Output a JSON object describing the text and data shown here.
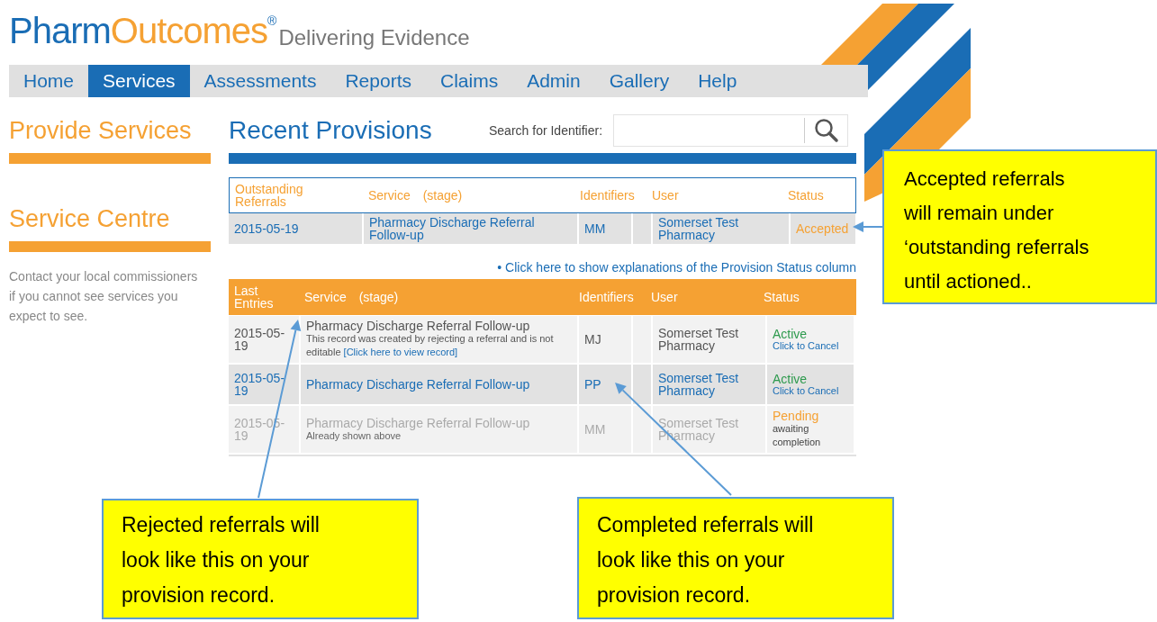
{
  "header": {
    "logo_first": "Pharm",
    "logo_second": "Outcomes",
    "registered_mark": "®",
    "tagline": "Delivering Evidence"
  },
  "nav": [
    {
      "label": "Home",
      "selected": false
    },
    {
      "label": "Services",
      "selected": true
    },
    {
      "label": "Assessments",
      "selected": false
    },
    {
      "label": "Reports",
      "selected": false
    },
    {
      "label": "Claims",
      "selected": false
    },
    {
      "label": "Admin",
      "selected": false
    },
    {
      "label": "Gallery",
      "selected": false
    },
    {
      "label": "Help",
      "selected": false
    }
  ],
  "sidebar": [
    {
      "title": "Provide Services"
    },
    {
      "title": "Service Centre",
      "text": "Contact your local commissioners if you cannot see services you expect to see."
    }
  ],
  "main": {
    "title": "Recent Provisions",
    "search": {
      "label": "Search for Identifier:"
    },
    "outstanding": {
      "columns": {
        "date": "Outstanding Referrals",
        "service": "Service",
        "stage": "(stage)",
        "identifiers": "Identifiers",
        "user": "User",
        "status": "Status"
      },
      "rows": [
        {
          "kind": "link",
          "date": "2015-05-19",
          "service": "Pharmacy Discharge Referral Follow-up",
          "identifiers": "MM",
          "user": "Somerset Test Pharmacy",
          "status": {
            "text": "Accepted",
            "color": "#f5a133"
          }
        }
      ]
    },
    "explanations_link": "• Click here to show explanations of the Provision Status column",
    "last_entries": {
      "columns": {
        "date": "Last Entries",
        "service": "Service",
        "stage": "(stage)",
        "identifiers": "Identifiers",
        "user": "User",
        "status": "Status"
      },
      "rows": [
        {
          "kind": "plain",
          "date": "2015-05-19",
          "service": "Pharmacy Discharge Referral Follow-up",
          "note": "This record was created by rejecting a referral and is not editable",
          "note_link": "[Click here to view record]",
          "identifiers": "MJ",
          "user": "Somerset Test Pharmacy",
          "status": {
            "text": "Active",
            "color": "#2e9a4e"
          },
          "status_action": "Click to Cancel"
        },
        {
          "kind": "link",
          "date": "2015-05-19",
          "service": "Pharmacy Discharge Referral Follow-up",
          "identifiers": "PP",
          "user": "Somerset Test Pharmacy",
          "status": {
            "text": "Active",
            "color": "#2e9a4e"
          },
          "status_action": "Click to Cancel"
        },
        {
          "kind": "faded",
          "date": "2015-05-19",
          "service": "Pharmacy Discharge Referral Follow-up",
          "note": "Already shown above",
          "identifiers": "MM",
          "user": "Somerset Test Pharmacy",
          "status": {
            "text": "Pending",
            "color": "#f5a133"
          },
          "status_note": "awaiting completion"
        }
      ]
    }
  },
  "callouts": [
    {
      "text": "Accepted referrals will remain under ‘outstanding referrals until actioned.."
    },
    {
      "text": "Rejected referrals will look like this on your provision record."
    },
    {
      "text": "Completed referrals will look like this on your provision record."
    }
  ]
}
